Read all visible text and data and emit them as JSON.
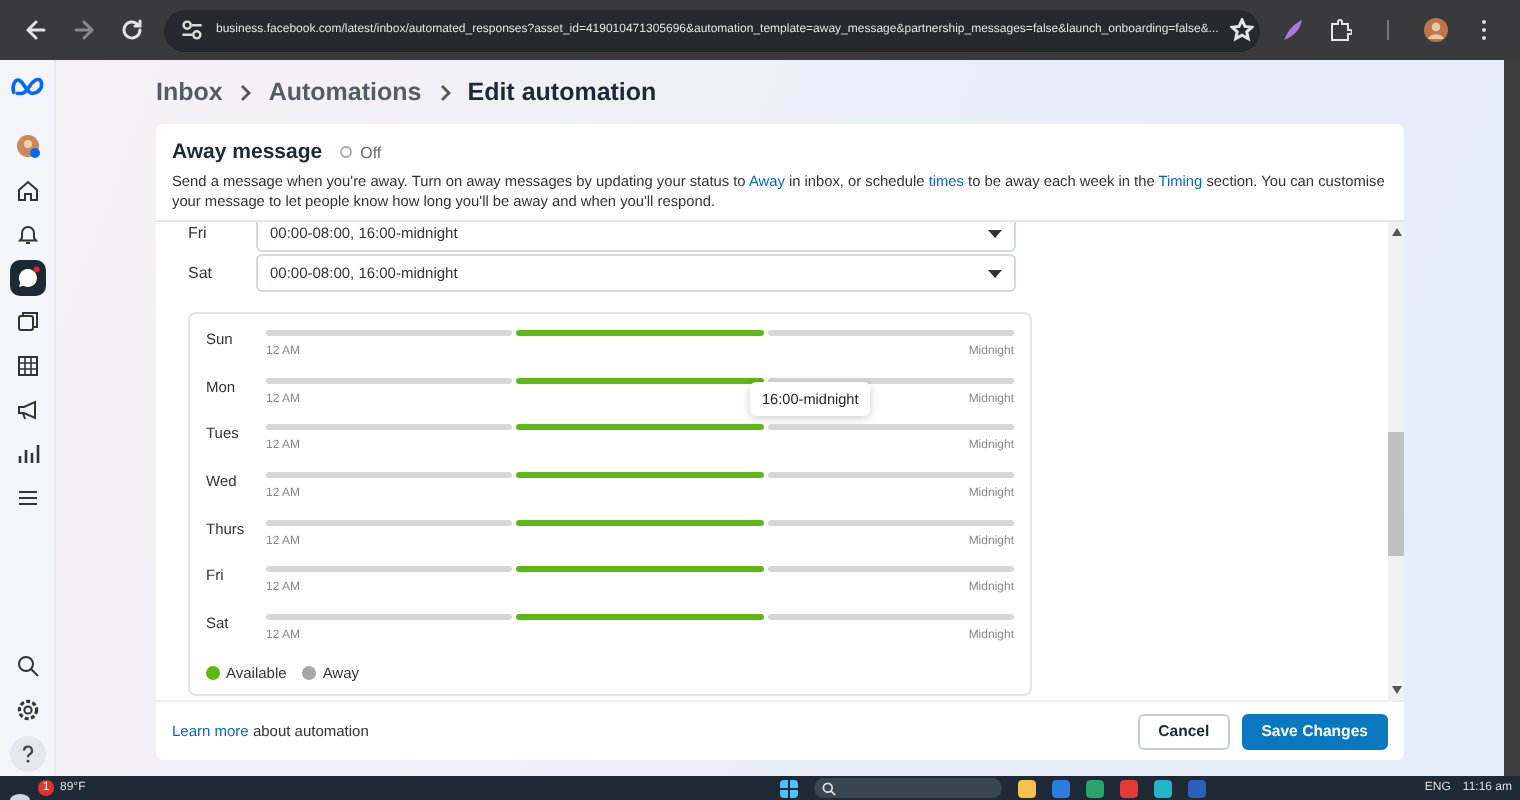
{
  "browser": {
    "url": "business.facebook.com/latest/inbox/automated_responses?asset_id=419010471305696&automation_template=away_message&partnership_messages=false&launch_onboarding=false&..."
  },
  "sidebar": {
    "items": [
      {
        "kind": "avatar",
        "selected": false
      },
      {
        "kind": "home",
        "selected": false
      },
      {
        "kind": "bell",
        "selected": false
      },
      {
        "kind": "chat",
        "selected": true
      },
      {
        "kind": "pages",
        "selected": false
      },
      {
        "kind": "table",
        "selected": false
      },
      {
        "kind": "megaphone",
        "selected": false
      },
      {
        "kind": "chart",
        "selected": false
      },
      {
        "kind": "menu",
        "selected": false
      }
    ],
    "bottom_items": [
      {
        "kind": "search",
        "selected": false
      },
      {
        "kind": "settings",
        "selected": false
      },
      {
        "kind": "help",
        "selected": false
      }
    ]
  },
  "breadcrumb": [
    "Inbox",
    "Automations",
    "Edit automation"
  ],
  "away_message": {
    "title": "Away message",
    "toggle": {
      "label": "Off",
      "on": false
    },
    "description": [
      {
        "text": "Send a message when you're away. Turn on away messages by updating your status to ",
        "link": false
      },
      {
        "text": "Away",
        "link": true
      },
      {
        "text": " in inbox, or schedule ",
        "link": false
      },
      {
        "text": "times",
        "link": true
      },
      {
        "text": " to be away each week in the ",
        "link": false
      },
      {
        "text": "Timing",
        "link": true
      },
      {
        "text": " section. You can customise your message to let people know how long you'll be away and when you'll respond.",
        "link": false
      }
    ]
  },
  "weekday_fields": [
    {
      "day": "Fri",
      "value": "00:00-08:00, 16:00-midnight"
    },
    {
      "day": "Sat",
      "value": "00:00-08:00, 16:00-midnight"
    }
  ],
  "schedule": {
    "days": [
      {
        "day": "Sun",
        "start": "12 AM",
        "end": "Midnight",
        "segments": [
          {
            "available": false
          },
          {
            "available": true
          },
          {
            "available": false
          }
        ]
      },
      {
        "day": "Mon",
        "start": "12 AM",
        "end": "Midnight",
        "segments": [
          {
            "available": false
          },
          {
            "available": true
          },
          {
            "available": false
          }
        ],
        "tooltip": "16:00-midnight"
      },
      {
        "day": "Tues",
        "start": "12 AM",
        "end": "Midnight",
        "segments": [
          {
            "available": false
          },
          {
            "available": true
          },
          {
            "available": false
          }
        ]
      },
      {
        "day": "Wed",
        "start": "12 AM",
        "end": "Midnight",
        "segments": [
          {
            "available": false
          },
          {
            "available": true
          },
          {
            "available": false
          }
        ]
      },
      {
        "day": "Thurs",
        "start": "12 AM",
        "end": "Midnight",
        "segments": [
          {
            "available": false
          },
          {
            "available": true
          },
          {
            "available": false
          }
        ]
      },
      {
        "day": "Fri",
        "start": "12 AM",
        "end": "Midnight",
        "segments": [
          {
            "available": false
          },
          {
            "available": true
          },
          {
            "available": false
          }
        ]
      },
      {
        "day": "Sat",
        "start": "12 AM",
        "end": "Midnight",
        "segments": [
          {
            "available": false
          },
          {
            "available": true
          },
          {
            "available": false
          }
        ]
      }
    ],
    "legend": [
      {
        "label": "Available",
        "color": "#5cb814"
      },
      {
        "label": "Away",
        "color": "#a6a6a6"
      }
    ]
  },
  "footer": {
    "link": "Learn more",
    "text": "about automation",
    "buttons": [
      {
        "label": "Cancel",
        "kind": "secondary"
      },
      {
        "label": "Save Changes",
        "kind": "primary"
      }
    ]
  },
  "taskbar": {
    "weather": "89°F",
    "badge": "1",
    "language": "ENG",
    "time": "11:16 am"
  }
}
